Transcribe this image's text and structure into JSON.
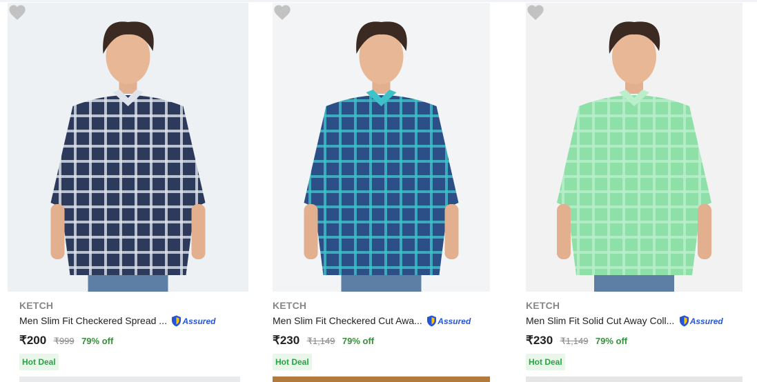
{
  "products": [
    {
      "brand": "KETCH",
      "title": "Men Slim Fit Checkered Spread ...",
      "assured_label": "Assured",
      "price": "₹200",
      "mrp": "₹999",
      "discount": "79% off",
      "badge": "Hot Deal",
      "image_alt": "Man in navy checkered shirt",
      "shirt_color": "#2d3a5c",
      "shirt_check_color": "#dfe4ec",
      "bg_color": "#edf1f4"
    },
    {
      "brand": "KETCH",
      "title": "Men Slim Fit Checkered Cut Awa...",
      "assured_label": "Assured",
      "price": "₹230",
      "mrp": "₹1,149",
      "discount": "79% off",
      "badge": "Hot Deal",
      "image_alt": "Man in teal and navy checkered shirt",
      "shirt_color": "#2b4f86",
      "shirt_check_color": "#3fc1c9",
      "bg_color": "#f3f4f6"
    },
    {
      "brand": "KETCH",
      "title": "Men Slim Fit Solid Cut Away Coll...",
      "assured_label": "Assured",
      "price": "₹230",
      "mrp": "₹1,149",
      "discount": "79% off",
      "badge": "Hot Deal",
      "image_alt": "Man in mint green solid shirt",
      "shirt_color": "#8fe0a8",
      "shirt_check_color": "#b9efcb",
      "bg_color": "#f2f2f2"
    }
  ],
  "colors": {
    "heart": "#c2c2c2",
    "brand_text": "#878787",
    "discount": "#388e3c",
    "assured": "#2455d8",
    "hot_deal_bg": "#e9f6ea",
    "hot_deal_text": "#26a541"
  }
}
